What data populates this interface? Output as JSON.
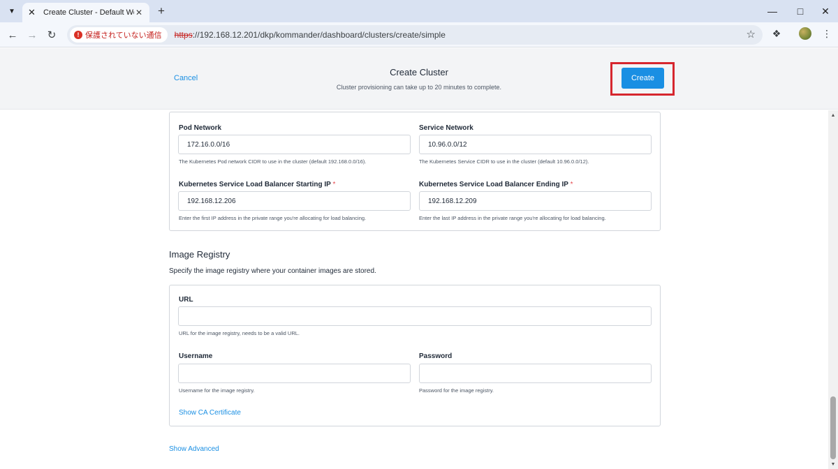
{
  "browser": {
    "tab": {
      "title": "Create Cluster - Default Worksp",
      "favicon": "x-logo-icon"
    },
    "omnibox": {
      "security_label": "保護されていない通信",
      "url_scheme": "https",
      "url_rest": "://192.168.12.201/dkp/kommander/dashboard/clusters/create/simple"
    }
  },
  "header": {
    "cancel_label": "Cancel",
    "title": "Create Cluster",
    "subtitle": "Cluster provisioning can take up to 20 minutes to complete.",
    "create_label": "Create",
    "highlight_color": "#d6262e",
    "accent_color": "#1a8fe3"
  },
  "network": {
    "pod_network": {
      "label": "Pod Network",
      "value": "172.16.0.0/16",
      "help": "The Kubernetes Pod network CIDR to use in the cluster (default 192.168.0.0/16)."
    },
    "service_network": {
      "label": "Service Network",
      "value": "10.96.0.0/12",
      "help": "The Kubernetes Service CIDR to use in the cluster (default 10.96.0.0/12)."
    },
    "lb_start": {
      "label": "Kubernetes Service Load Balancer Starting IP",
      "required_mark": "*",
      "value": "192.168.12.206",
      "help": "Enter the first IP address in the private range you're allocating for load balancing."
    },
    "lb_end": {
      "label": "Kubernetes Service Load Balancer Ending IP",
      "required_mark": "*",
      "value": "192.168.12.209",
      "help": "Enter the last IP address in the private range you're allocating for load balancing."
    }
  },
  "registry": {
    "title": "Image Registry",
    "description": "Specify the image registry where your container images are stored.",
    "url": {
      "label": "URL",
      "value": "",
      "help": "URL for the image registry, needs to be a valid URL."
    },
    "username": {
      "label": "Username",
      "value": "",
      "help": "Username for the image registry."
    },
    "password": {
      "label": "Password",
      "value": "",
      "help": "Password for the image registry."
    },
    "show_ca_label": "Show CA Certificate"
  },
  "show_advanced_label": "Show Advanced"
}
